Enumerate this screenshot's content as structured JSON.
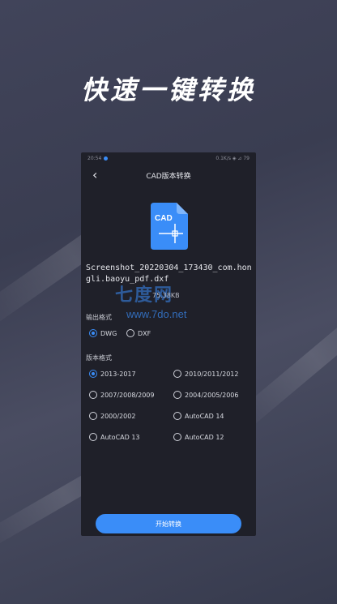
{
  "headline": "快速一键转换",
  "status": {
    "time": "20:54",
    "right": "0.1K/s ◈ ⊿ 79"
  },
  "nav": {
    "back_glyph": "‹",
    "title": "CAD版本转换"
  },
  "file": {
    "icon_label": "CAD",
    "name": "Screenshot_20220304_173430_com.hongli.baoyu_pdf.dxf",
    "size": "75.38KB"
  },
  "watermark": {
    "cn": "七度网",
    "url": "www.7do.net"
  },
  "output_format": {
    "label": "输出格式",
    "options": [
      {
        "label": "DWG",
        "selected": true
      },
      {
        "label": "DXF",
        "selected": false
      }
    ]
  },
  "version_format": {
    "label": "版本格式",
    "options": [
      {
        "label": "2013-2017",
        "selected": true
      },
      {
        "label": "2010/2011/2012",
        "selected": false
      },
      {
        "label": "2007/2008/2009",
        "selected": false
      },
      {
        "label": "2004/2005/2006",
        "selected": false
      },
      {
        "label": "2000/2002",
        "selected": false
      },
      {
        "label": "AutoCAD 14",
        "selected": false
      },
      {
        "label": "AutoCAD 13",
        "selected": false
      },
      {
        "label": "AutoCAD 12",
        "selected": false
      }
    ]
  },
  "start_button": "开始转换",
  "colors": {
    "accent": "#3a8df8",
    "phone_bg": "#1f2029",
    "page_bg": "#3f4256"
  }
}
